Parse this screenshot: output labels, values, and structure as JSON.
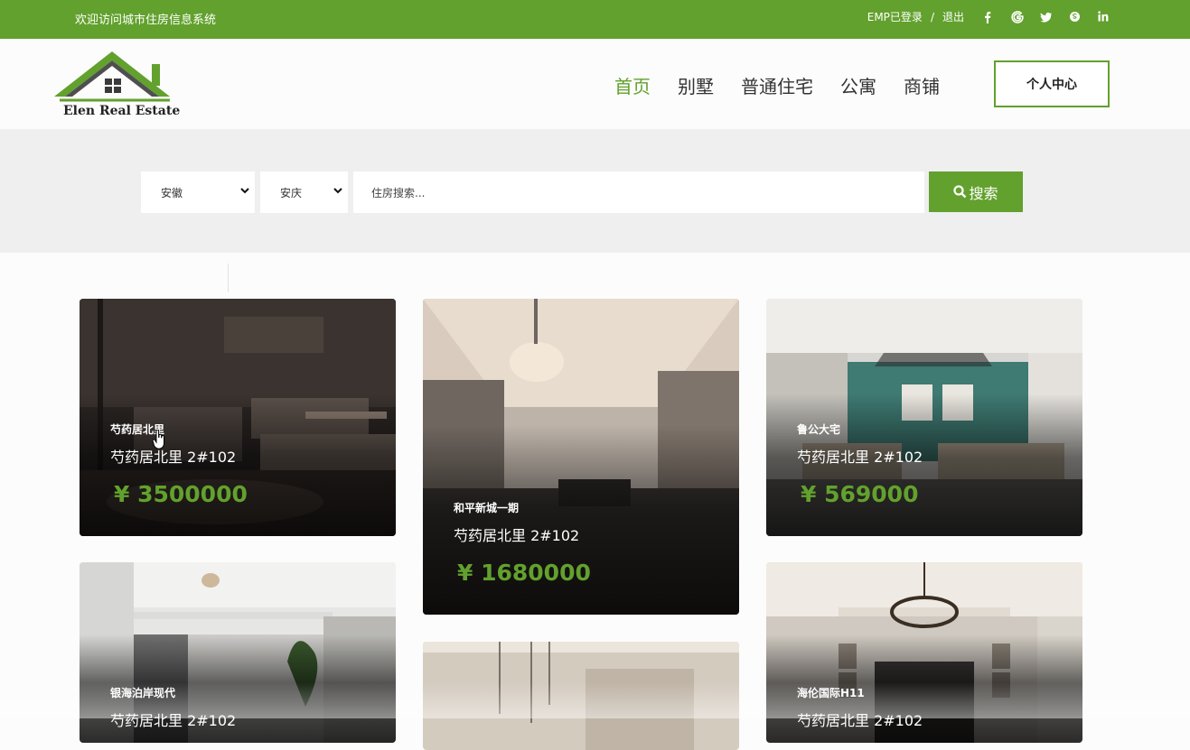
{
  "topbar": {
    "welcome": "欢迎访问城市住房信息系统",
    "user": "EMP已登录",
    "separator": "/",
    "logout": "退出",
    "socials": [
      "facebook-icon",
      "google-icon",
      "twitter-icon",
      "skype-icon",
      "linkedin-icon"
    ]
  },
  "brand": {
    "name": "Elen Real Estate"
  },
  "nav": {
    "items": [
      "首页",
      "别墅",
      "普通住宅",
      "公寓",
      "商铺"
    ],
    "active_index": 0,
    "user_center": "个人中心"
  },
  "search": {
    "province": "安徽",
    "city": "安庆",
    "placeholder": "住房搜索...",
    "button": "搜索"
  },
  "colors": {
    "accent": "#62a12d",
    "topbar": "#62a12d",
    "band": "#efefef"
  },
  "listings": [
    {
      "category": "芍药居北里",
      "address": "芍药居北里 2#102",
      "price": "¥ 3500000"
    },
    {
      "category": "和平新城一期",
      "address": "芍药居北里 2#102",
      "price": "¥ 1680000"
    },
    {
      "category": "鲁公大宅",
      "address": "芍药居北里 2#102",
      "price": "¥ 569000"
    },
    {
      "category": "银海泊岸现代",
      "address": "芍药居北里 2#102",
      "price": ""
    },
    {
      "category": "",
      "address": "",
      "price": ""
    },
    {
      "category": "海伦国际H11",
      "address": "芍药居北里 2#102",
      "price": ""
    }
  ]
}
